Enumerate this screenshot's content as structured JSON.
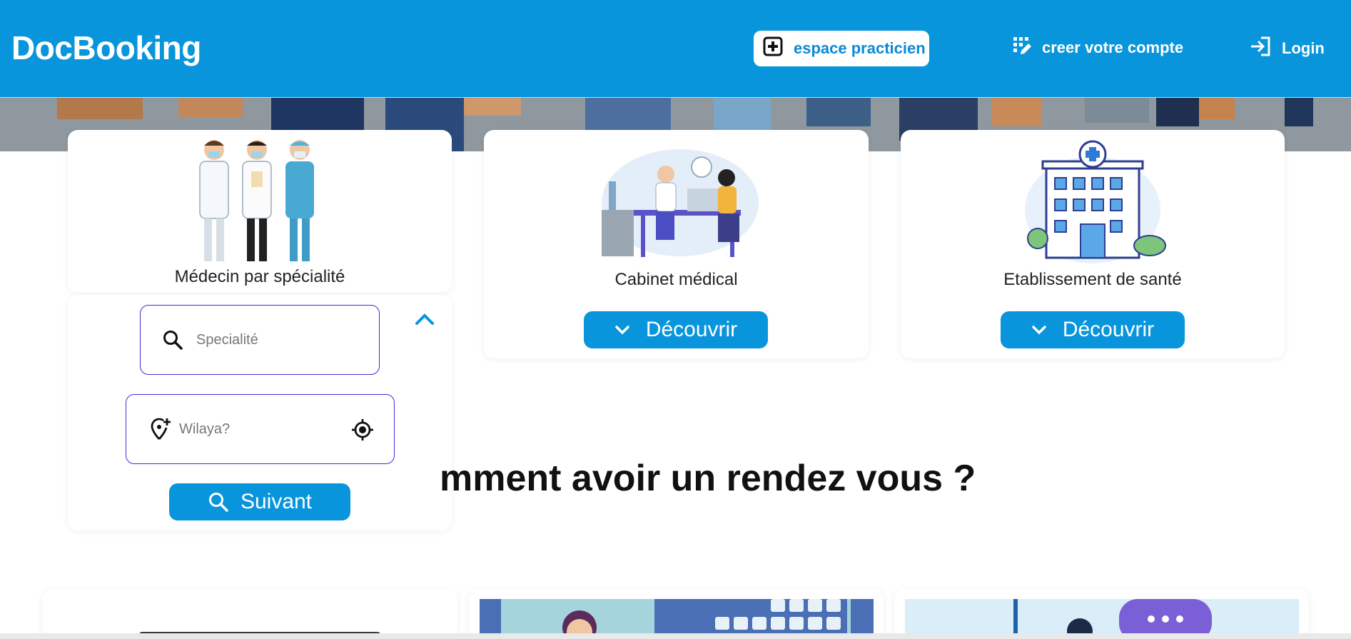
{
  "brand": "DocBooking",
  "nav": {
    "practitioner_label": "espace practicien",
    "create_account_label": "creer votre compte",
    "login_label": "Login"
  },
  "cards": {
    "specialty_title": "Médecin par spécialité",
    "cabinet_title": "Cabinet médical",
    "etablissement_title": "Etablissement de santé",
    "discover_label": "Découvrir"
  },
  "search": {
    "specialty_placeholder": "Specialité",
    "wilaya_placeholder": "Wilaya?",
    "next_label": "Suivant"
  },
  "section_heading": "mment avoir un rendez vous ?",
  "colors": {
    "primary": "#0895dc",
    "field_border": "#3a2fd6",
    "white": "#ffffff"
  },
  "icons": [
    "plus-square-icon",
    "create-account-icon",
    "login-icon",
    "search-icon",
    "add-location-icon",
    "my-location-icon",
    "chevron-up-icon",
    "chevron-down-icon"
  ]
}
